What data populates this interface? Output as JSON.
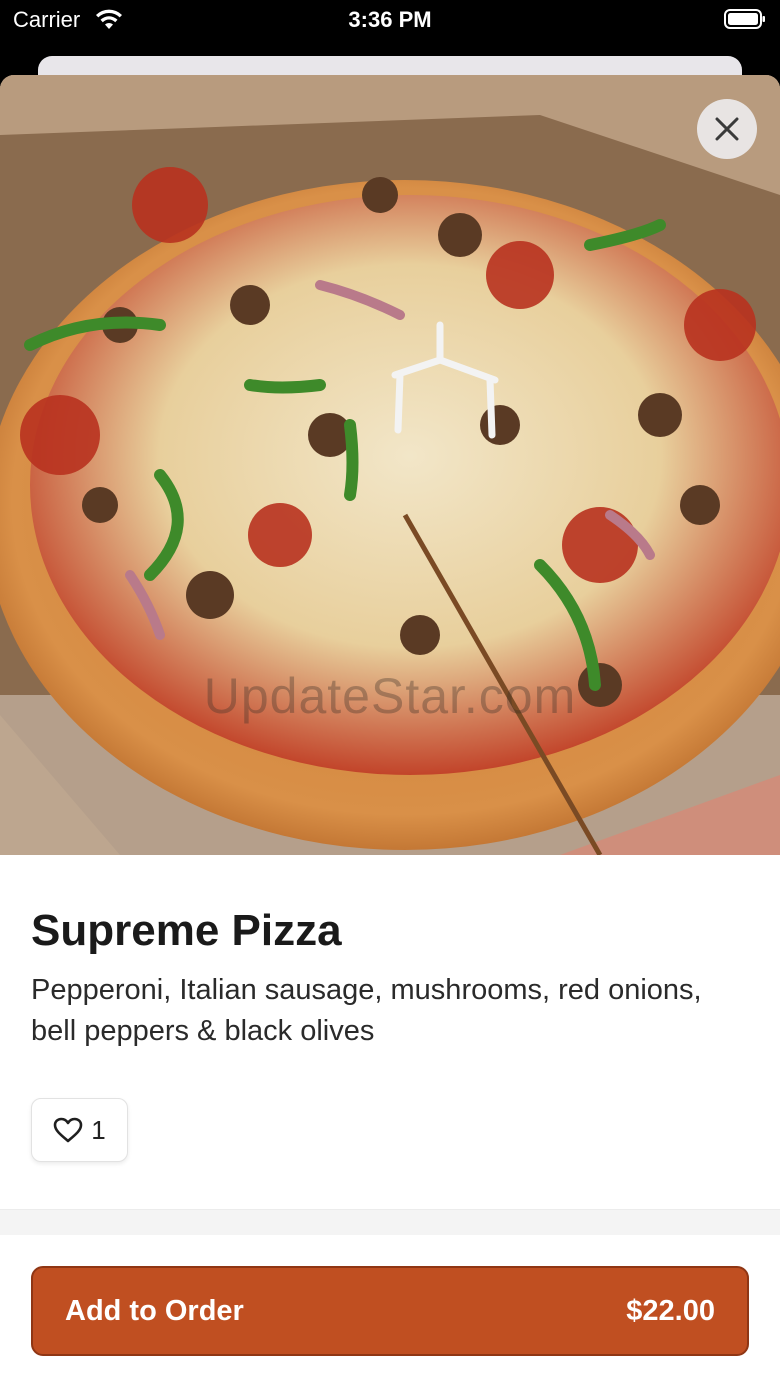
{
  "status_bar": {
    "carrier": "Carrier",
    "time": "3:36 PM",
    "wifi_icon": "wifi-icon",
    "battery_icon": "battery-icon"
  },
  "hero": {
    "image": "supreme-pizza-photo",
    "watermark": "UpdateStar.com",
    "close_icon": "close-icon"
  },
  "item": {
    "title": "Supreme Pizza",
    "description": "Pepperoni, Italian sausage, mushrooms, red onions, bell peppers & black olives",
    "like_icon": "heart-outline-icon",
    "like_count": "1"
  },
  "footer": {
    "add_label": "Add to Order",
    "price": "$22.00"
  },
  "colors": {
    "accent": "#c04f21",
    "accent_border": "#8f3614",
    "title_text": "#1a1a1a",
    "background": "#ffffff"
  }
}
